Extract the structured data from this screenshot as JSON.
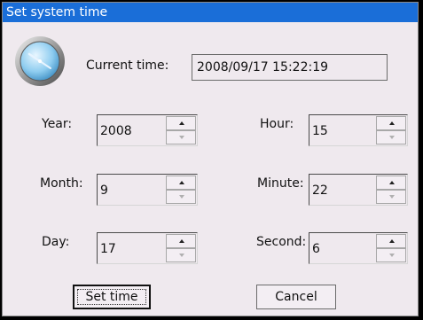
{
  "window": {
    "title": "Set system time"
  },
  "icons": {
    "clock": "clock-icon"
  },
  "current": {
    "label": "Current time:",
    "value": "2008/09/17 15:22:19"
  },
  "fields": {
    "year": {
      "label": "Year:",
      "value": "2008"
    },
    "month": {
      "label": "Month:",
      "value": "9"
    },
    "day": {
      "label": "Day:",
      "value": "17"
    },
    "hour": {
      "label": "Hour:",
      "value": "15"
    },
    "minute": {
      "label": "Minute:",
      "value": "22"
    },
    "second": {
      "label": "Second:",
      "value": "6"
    }
  },
  "buttons": {
    "set_time": "Set time",
    "cancel": "Cancel"
  },
  "colors": {
    "titlebar": "#1a6ed8",
    "window_bg": "#efe9ee"
  }
}
